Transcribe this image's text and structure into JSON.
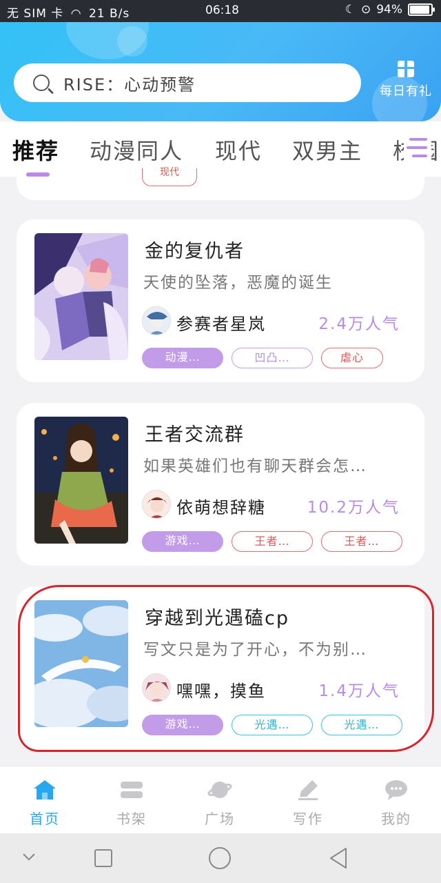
{
  "status_bar": {
    "carrier": "无 SIM 卡",
    "speed": "21 B/s",
    "time": "06:18",
    "battery": "94%",
    "battery_level": 0.94
  },
  "header": {
    "search_placeholder": "RISE：心动预警",
    "daily_gift_label": "每日有礼"
  },
  "tabs": [
    "推荐",
    "动漫同人",
    "现代",
    "双男主",
    "校园"
  ],
  "partial_card": {
    "tag": "现代"
  },
  "cards": [
    {
      "title": "金的复仇者",
      "desc": "天使的坠落，恶魔的诞生",
      "author": "参赛者星岚",
      "popularity": "2.4万人气",
      "tags": [
        "动漫…",
        "凹凸…",
        "虐心"
      ]
    },
    {
      "title": "王者交流群",
      "desc": "如果英雄们也有聊天群会怎…",
      "author": "依萌想辞糖",
      "popularity": "10.2万人气",
      "tags": [
        "游戏…",
        "王者…",
        "王者…"
      ]
    },
    {
      "title": "穿越到光遇磕cp",
      "desc": "写文只是为了开心，不为别…",
      "author": "嘿嘿，摸鱼",
      "popularity": "1.4万人气",
      "tags": [
        "游戏…",
        "光遇…",
        "光遇…"
      ]
    }
  ],
  "bottom_nav": [
    "首页",
    "书架",
    "广场",
    "写作",
    "我的"
  ],
  "colors": {
    "accent": "#25a8ef",
    "purple": "#b98ae6",
    "red_tag": "#e36b6b",
    "cyan_tag": "#3cc2d8",
    "annotation": "#d9222a"
  }
}
